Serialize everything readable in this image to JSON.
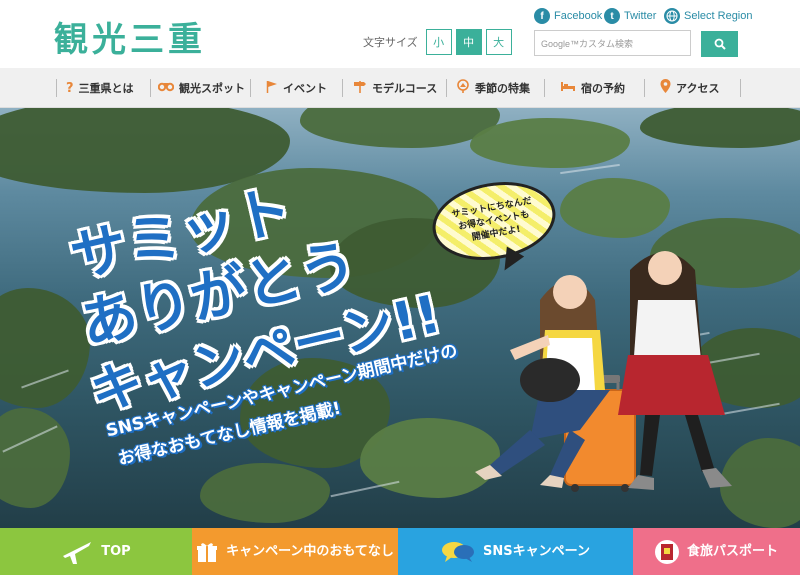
{
  "header": {
    "logo": "観光三重",
    "social": {
      "facebook": "Facebook",
      "twitter": "Twitter",
      "region": "Select Region"
    },
    "font_size": {
      "label": "文字サイズ",
      "small": "小",
      "medium": "中",
      "large": "大",
      "selected": "中"
    },
    "search": {
      "placeholder": "Google™カスタム検索"
    }
  },
  "nav": {
    "items": [
      {
        "label": "三重県とは",
        "icon": "question-icon"
      },
      {
        "label": "観光スポット",
        "icon": "binoculars-icon"
      },
      {
        "label": "イベント",
        "icon": "flag-icon"
      },
      {
        "label": "モデルコース",
        "icon": "signpost-icon"
      },
      {
        "label": "季節の特集",
        "icon": "season-icon"
      },
      {
        "label": "宿の予約",
        "icon": "bed-icon"
      },
      {
        "label": "アクセス",
        "icon": "map-pin-icon"
      }
    ]
  },
  "hero": {
    "headline_1": "サミット",
    "headline_2": "ありがとう",
    "headline_3": "キャンペーン!!",
    "subline_1": "SNSキャンペーンやキャンペーン期間中だけの",
    "subline_2": "お得なおもてなし情報を掲載!",
    "bubble_1": "サミットにちなんだ",
    "bubble_2": "お得なイベントも",
    "bubble_3": "開催中だよ!"
  },
  "bottom": {
    "top": "TOP",
    "campaign": "キャンペーン中のおもてなし",
    "sns": "SNSキャンペーン",
    "food": "食旅パスポート"
  },
  "colors": {
    "brand": "#3bb09a",
    "top": "#8cc63f",
    "campaign": "#f39a2e",
    "sns": "#29a3e0",
    "food": "#ef6f8a",
    "headline": "#1f6fc4"
  }
}
